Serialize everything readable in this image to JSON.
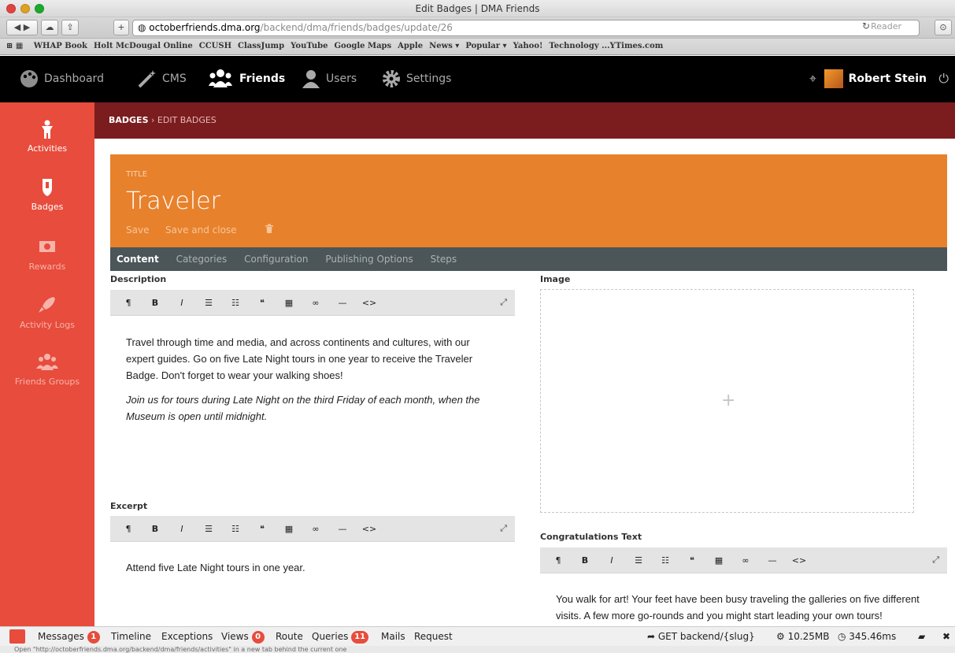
{
  "window": {
    "title": "Edit Badges | DMA Friends"
  },
  "browser": {
    "url_host": "octoberfriends.dma.org",
    "url_path": "/backend/dma/friends/badges/update/26",
    "reader_label": "Reader",
    "bookmarks": [
      "WHAP Book",
      "Holt McDougal Online",
      "CCUSH",
      "ClassJump",
      "YouTube",
      "Google Maps",
      "Apple",
      "News ▾",
      "Popular ▾",
      "Yahoo!",
      "Technology ...YTimes.com"
    ]
  },
  "topnav": {
    "items": [
      {
        "label": "Dashboard",
        "icon": "palette-icon"
      },
      {
        "label": "CMS",
        "icon": "magic-wand-icon"
      },
      {
        "label": "Friends",
        "icon": "friends-icon"
      },
      {
        "label": "Users",
        "icon": "user-icon"
      },
      {
        "label": "Settings",
        "icon": "gear-icon"
      }
    ],
    "user_name": "Robert Stein"
  },
  "sidenav": {
    "items": [
      {
        "label": "Activities",
        "icon": "person-icon"
      },
      {
        "label": "Badges",
        "icon": "shield-icon"
      },
      {
        "label": "Rewards",
        "icon": "money-icon"
      },
      {
        "label": "Activity Logs",
        "icon": "rocket-icon"
      },
      {
        "label": "Friends Groups",
        "icon": "group-icon"
      }
    ]
  },
  "breadcrumb": {
    "parent": "BADGES",
    "separator": "›",
    "current": "EDIT BADGES"
  },
  "form": {
    "title_label": "TITLE",
    "title_value": "Traveler",
    "save_label": "Save",
    "save_close_label": "Save and close"
  },
  "tabs": [
    "Content",
    "Categories",
    "Configuration",
    "Publishing Options",
    "Steps"
  ],
  "fields": {
    "description_label": "Description",
    "description_p1": "Travel through time and media, and across continents and cultures, with our expert guides. Go on five Late Night tours in one year to receive the Traveler Badge. Don't forget to wear your walking shoes!",
    "description_p2": "Join us for tours during Late Night on the third Friday of each month, when the Museum is open until midnight.",
    "excerpt_label": "Excerpt",
    "excerpt_text": "Attend five Late Night tours in one year.",
    "image_label": "Image",
    "congrats_label": "Congratulations Text",
    "congrats_text": "You walk for art! Your feet have been busy traveling the galleries on five different visits. A few more go-rounds and you might start leading your own tours!"
  },
  "editor_toolbar": [
    "¶",
    "B",
    "I",
    "☰",
    "☷",
    "❝",
    "▦",
    "∞",
    "—",
    "<>"
  ],
  "debugbar": {
    "messages": "Messages",
    "messages_count": "1",
    "timeline": "Timeline",
    "exceptions": "Exceptions",
    "views": "Views",
    "views_count": "0",
    "route": "Route",
    "queries": "Queries",
    "queries_count": "11",
    "mails": "Mails",
    "request": "Request",
    "route_info": "GET backend/{slug}",
    "memory": "10.25MB",
    "time": "345.46ms"
  },
  "statusbar": "Open \"http://octoberfriends.dma.org/backend/dma/friends/activities\" in a new tab behind the current one"
}
